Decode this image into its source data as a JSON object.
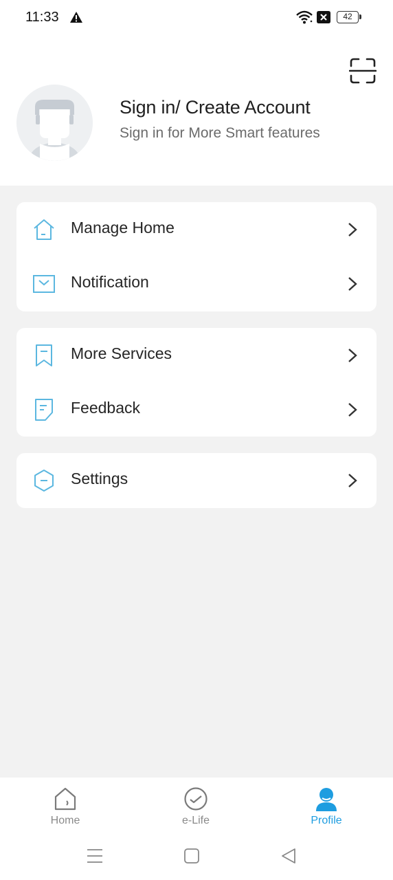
{
  "status_bar": {
    "time": "11:33",
    "battery": "42",
    "icons": [
      "warning-icon",
      "wifi-icon",
      "sim-off-icon",
      "battery-icon"
    ]
  },
  "header": {
    "scan_icon": "scan-icon",
    "title": "Sign in/ Create Account",
    "subtitle": "Sign in for More Smart features"
  },
  "menu": {
    "group1": [
      {
        "label": "Manage Home",
        "icon": "home-outline-icon"
      },
      {
        "label": "Notification",
        "icon": "mail-icon"
      }
    ],
    "group2": [
      {
        "label": "More Services",
        "icon": "bookmark-icon"
      },
      {
        "label": "Feedback",
        "icon": "note-icon"
      }
    ],
    "group3": [
      {
        "label": "Settings",
        "icon": "hexagon-settings-icon"
      }
    ]
  },
  "bottom_nav": {
    "tabs": [
      {
        "label": "Home",
        "icon": "home-icon",
        "active": false
      },
      {
        "label": "e-Life",
        "icon": "elife-icon",
        "active": false
      },
      {
        "label": "Profile",
        "icon": "profile-icon",
        "active": true
      }
    ]
  },
  "colors": {
    "accent": "#1e9de0",
    "icon_outline": "#5bb7e0",
    "inactive": "#8a8a8a",
    "page_bg": "#f2f2f2"
  }
}
